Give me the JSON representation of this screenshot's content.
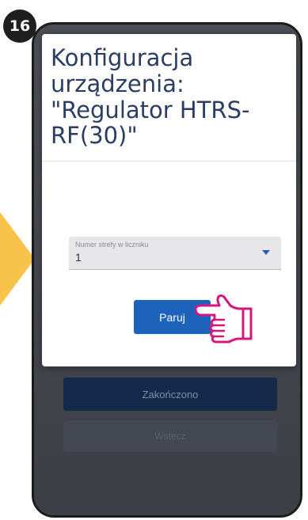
{
  "step_number": "16",
  "dialog": {
    "title_lines": [
      "Konfiguracja",
      "urządzenia:",
      "\"Regulator HTRS-",
      "RF(30)\""
    ],
    "select": {
      "label": "Numer strefy w liczniku",
      "value": "1"
    },
    "pair_button_label": "Paruj"
  },
  "background": {
    "done_button_label": "Zakończono",
    "back_button_label": "Wstecz"
  },
  "colors": {
    "title": "#2b3d63",
    "primary_button": "#1d63bb",
    "hand_outline": "#d4177f",
    "arrow": "#f8c34a"
  },
  "icons": {
    "pointer": "pointing-hand-icon",
    "caret": "dropdown-caret-icon"
  }
}
